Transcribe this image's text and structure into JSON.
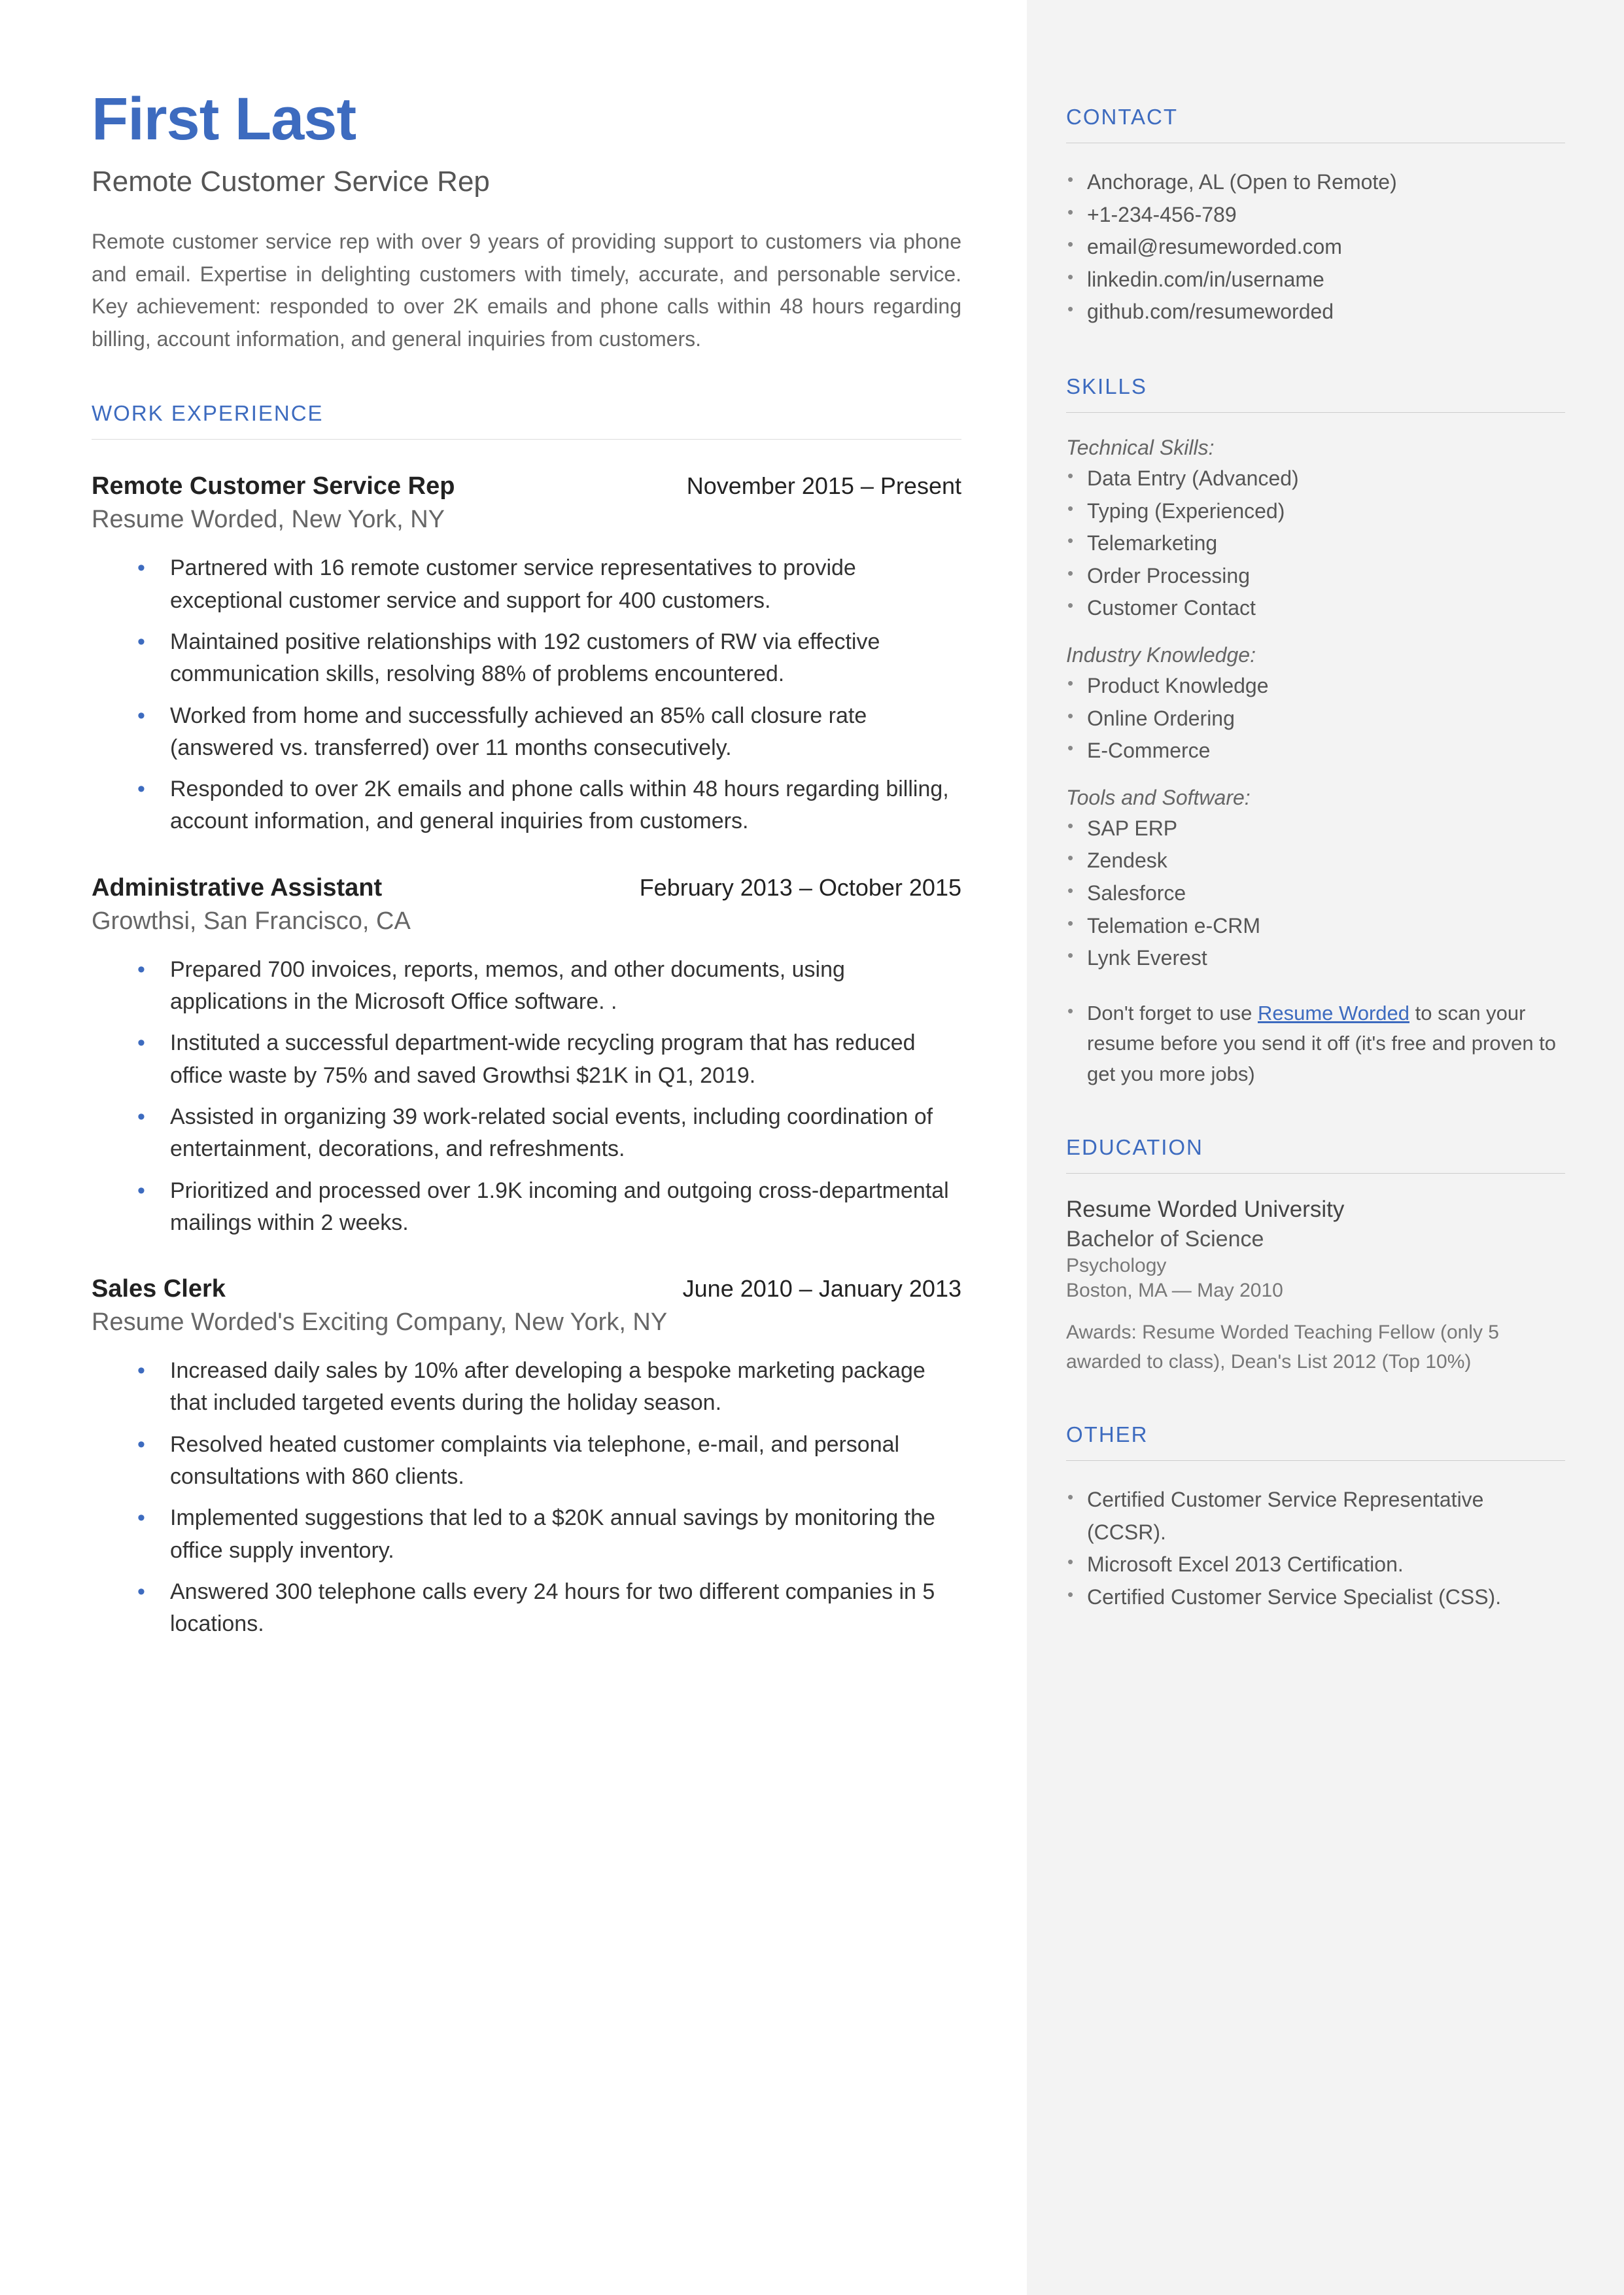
{
  "name": "First Last",
  "title": "Remote Customer Service Rep",
  "summary": "Remote customer service rep with over 9 years of providing support to customers via phone and email. Expertise in delighting customers with timely, accurate, and personable service. Key achievement: responded to over 2K emails and phone calls within 48 hours regarding billing, account information, and general inquiries from customers.",
  "workHeader": "WORK EXPERIENCE",
  "jobs": [
    {
      "title": "Remote Customer Service Rep",
      "dates": "November 2015 – Present",
      "company": "Resume Worded, New York, NY",
      "bullets": [
        "Partnered with 16 remote customer service representatives to provide exceptional customer service and support for 400 customers.",
        "Maintained positive relationships with 192 customers of RW via effective communication skills, resolving 88% of problems encountered.",
        "Worked from home and successfully achieved an 85% call closure rate (answered vs. transferred) over 11 months consecutively.",
        "Responded to over 2K emails and phone calls within 48 hours regarding billing, account information, and general inquiries from customers."
      ]
    },
    {
      "title": "Administrative Assistant",
      "dates": "February 2013 – October 2015",
      "company": "Growthsi, San Francisco, CA",
      "bullets": [
        "Prepared 700 invoices, reports, memos, and other documents, using applications in the Microsoft Office software. .",
        "Instituted a successful department-wide recycling program that has reduced office waste by 75% and saved Growthsi $21K in Q1, 2019.",
        "Assisted in organizing 39 work-related social events, including coordination of entertainment, decorations, and refreshments.",
        "Prioritized and processed over 1.9K incoming and outgoing cross-departmental mailings within 2 weeks."
      ]
    },
    {
      "title": "Sales Clerk",
      "dates": "June 2010 – January 2013",
      "company": "Resume Worded's Exciting Company, New York, NY",
      "bullets": [
        "Increased daily sales by 10% after developing a bespoke marketing package that included targeted events during the holiday season.",
        "Resolved heated customer complaints via telephone, e-mail, and personal consultations with 860 clients.",
        "Implemented suggestions that led to a $20K annual savings by monitoring the office supply inventory.",
        "Answered 300 telephone calls every 24 hours for two different companies in 5 locations."
      ]
    }
  ],
  "contactHeader": "CONTACT",
  "contact": [
    "Anchorage, AL (Open to Remote)",
    "+1-234-456-789",
    "email@resumeworded.com",
    "linkedin.com/in/username",
    "github.com/resumeworded"
  ],
  "skillsHeader": "SKILLS",
  "skillGroups": [
    {
      "label": "Technical Skills:",
      "items": [
        "Data Entry (Advanced)",
        "Typing (Experienced)",
        "Telemarketing",
        "Order Processing",
        "Customer Contact"
      ]
    },
    {
      "label": "Industry Knowledge:",
      "items": [
        "Product Knowledge",
        "Online Ordering",
        "E-Commerce"
      ]
    },
    {
      "label": "Tools and Software:",
      "items": [
        "SAP ERP",
        "Zendesk",
        "Salesforce",
        "Telemation e-CRM",
        "Lynk Everest"
      ]
    }
  ],
  "notePre": "Don't forget to use ",
  "noteLink": "Resume Worded",
  "notePost": " to scan your resume before you send it off (it's free and proven to get you more jobs)",
  "eduHeader": "EDUCATION",
  "education": {
    "school": "Resume Worded University",
    "degree": "Bachelor of Science",
    "major": "Psychology",
    "loc": "Boston, MA — May 2010",
    "awards": "Awards: Resume Worded Teaching Fellow (only 5 awarded to class), Dean's List 2012 (Top 10%)"
  },
  "otherHeader": "OTHER",
  "other": [
    "Certified Customer Service Representative (CCSR).",
    "Microsoft Excel 2013 Certification.",
    "Certified Customer Service Specialist (CSS)."
  ]
}
